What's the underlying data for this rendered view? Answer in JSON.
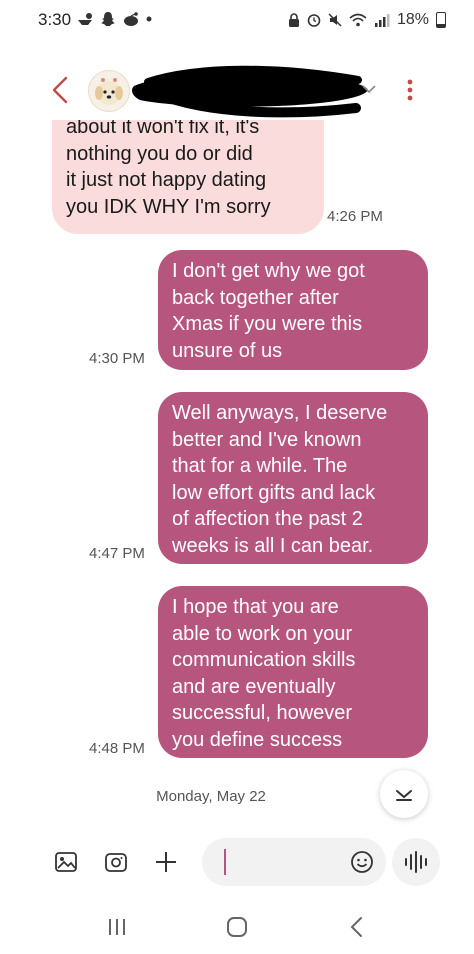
{
  "status_bar": {
    "time": "3:30",
    "battery": "18%",
    "icons": [
      "weather-icon",
      "snapchat-icon",
      "reddit-icon",
      "dot-icon",
      "lock-icon",
      "alarm-icon",
      "mute-icon",
      "wifi-icon",
      "signal-icon",
      "battery-icon"
    ]
  },
  "header": {
    "contact_name": "",
    "back_icon": "chevron-left-icon",
    "more_icon": "vertical-dots-icon"
  },
  "messages": [
    {
      "direction": "received",
      "text": "about it won't fix it, it's\nnothing you do or did\nit just not happy dating\nyou IDK WHY I'm sorry",
      "time": "4:26 PM"
    },
    {
      "direction": "sent",
      "text": "I don't get why we got\nback together after\nXmas if you were this\nunsure of us",
      "time": "4:30 PM"
    },
    {
      "direction": "sent",
      "text": "Well anyways, I deserve\nbetter and I've known\nthat for a while. The\nlow effort gifts and lack\nof affection the past 2\nweeks is all I can bear.",
      "time": "4:47 PM"
    },
    {
      "direction": "sent",
      "text": "I hope that you are\nable to work on your\ncommunication skills\nand are eventually\nsuccessful, however\nyou define success",
      "time": "4:48 PM"
    }
  ],
  "date_separator": "Monday, May 22",
  "composer": {
    "input_value": "",
    "placeholder": ""
  },
  "colors": {
    "sent_bubble": "#b6557e",
    "received_bubble": "#f9dcdb",
    "accent": "#b6557e"
  }
}
